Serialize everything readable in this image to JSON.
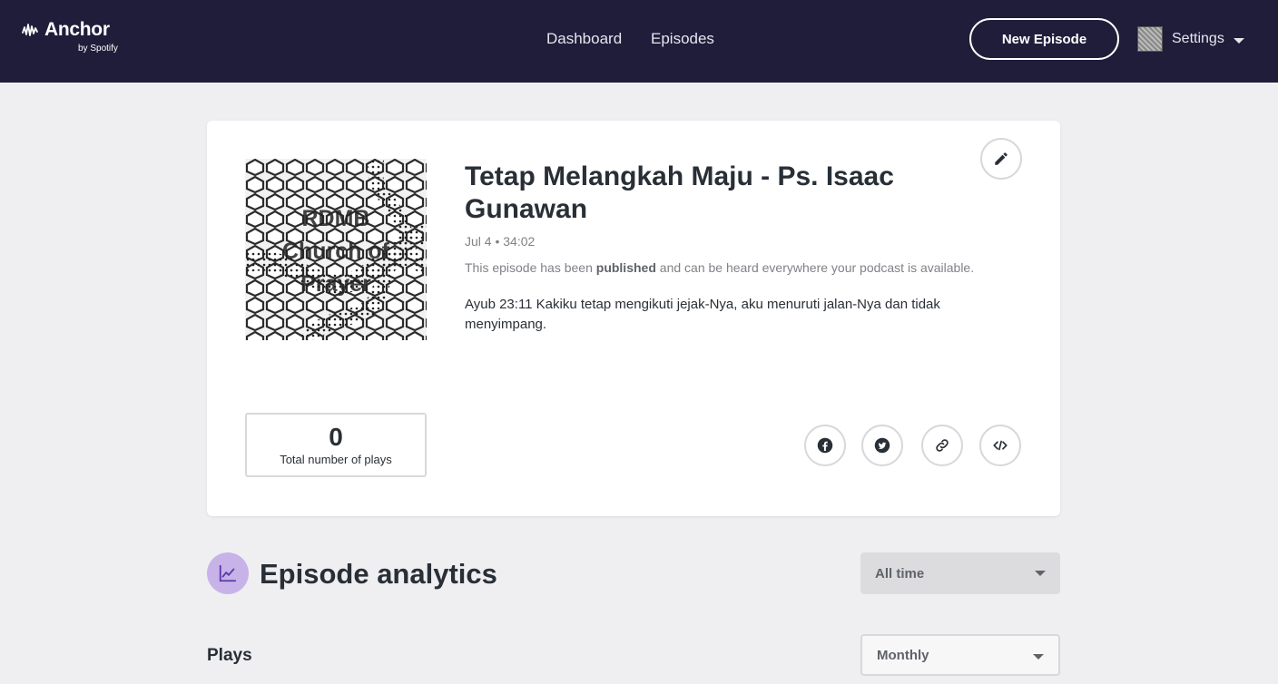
{
  "header": {
    "logo_name": "Anchor",
    "logo_sub": "by Spotify",
    "nav": {
      "dashboard": "Dashboard",
      "episodes": "Episodes"
    },
    "new_episode_label": "New Episode",
    "settings_label": "Settings"
  },
  "episode": {
    "cover_text": [
      "RDMB",
      "Church of",
      "Prayer"
    ],
    "title": "Tetap Melangkah Maju - Ps. Isaac Gunawan",
    "meta": "Jul 4 • 34:02",
    "status_prefix": "This episode has been",
    "status_bold": "published",
    "status_suffix": "and can be heard everywhere your podcast is available.",
    "description": "Ayub 23:11 Kakiku tetap mengikuti jejak-Nya, aku menuruti jalan-Nya dan tidak menyimpang.",
    "plays_count": "0",
    "plays_label": "Total number of plays"
  },
  "analytics": {
    "title": "Episode analytics",
    "time_range": "All time",
    "plays_heading": "Plays",
    "granularity": "Monthly"
  },
  "colors": {
    "header_bg": "#1f1d3a",
    "page_bg": "#efeff1",
    "accent_circle": "#c7b3e8",
    "accent_icon": "#5b3aa8"
  },
  "icons": [
    "anchor-wave-icon",
    "avatar",
    "caret-down-icon",
    "pencil-icon",
    "facebook-icon",
    "twitter-icon",
    "link-icon",
    "embed-code-icon",
    "analytics-chart-icon"
  ]
}
